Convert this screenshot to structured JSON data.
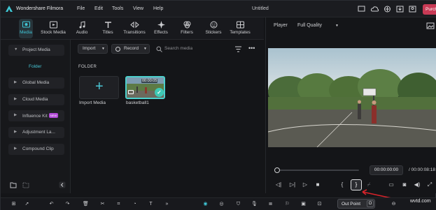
{
  "app": {
    "name": "Wondershare Filmora",
    "doc_title": "Untitled",
    "purchase_label": "Purchase"
  },
  "menu": [
    "File",
    "Edit",
    "Tools",
    "View",
    "Help"
  ],
  "tabs": [
    {
      "label": "Media",
      "icon": "media-icon",
      "active": true
    },
    {
      "label": "Stock Media",
      "icon": "stock-media-icon"
    },
    {
      "label": "Audio",
      "icon": "audio-note-icon"
    },
    {
      "label": "Titles",
      "icon": "titles-t-icon"
    },
    {
      "label": "Transitions",
      "icon": "transitions-icon"
    },
    {
      "label": "Effects",
      "icon": "effects-sparkle-icon"
    },
    {
      "label": "Filters",
      "icon": "filters-icon"
    },
    {
      "label": "Stickers",
      "icon": "stickers-icon"
    },
    {
      "label": "Templates",
      "icon": "templates-icon"
    }
  ],
  "sidebar": {
    "items": [
      {
        "label": "Project Media",
        "expanded": true
      },
      {
        "label": "Global Media"
      },
      {
        "label": "Cloud Media"
      },
      {
        "label": "Influence Kit",
        "badge": "NEW"
      },
      {
        "label": "Adjustment La..."
      },
      {
        "label": "Compound Clip"
      }
    ],
    "folder": "Folder"
  },
  "media": {
    "import_label": "Import",
    "record_label": "Record",
    "search_placeholder": "Search media",
    "folder_heading": "FOLDER",
    "import_tile_label": "Import Media",
    "clip": {
      "name": "basketball1",
      "duration": "00:00:05"
    }
  },
  "player": {
    "label": "Player",
    "quality": "Full Quality",
    "current_time": "00:00:00:00",
    "total_time": "/ 00:00:08:18",
    "progress_fraction": 0.0
  },
  "tooltip": {
    "text": "Out Point",
    "key": "O"
  },
  "watermark": "wvtd.com",
  "colors": {
    "accent": "#40c6d6",
    "purchase": "#c83a55",
    "selection": "#4bd0cc"
  }
}
